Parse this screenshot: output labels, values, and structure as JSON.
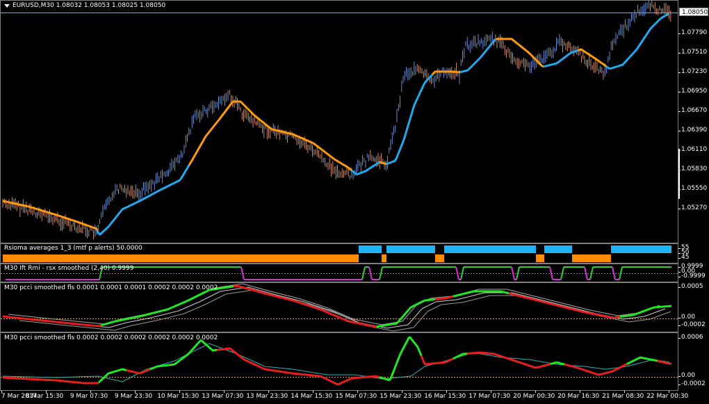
{
  "main": {
    "symbol": "EURUSD,M30",
    "ohlc": "1.08032 1.08053 1.08025 1.08050",
    "current_price": "1.08050",
    "price_ticks": [
      "1.07790",
      "1.07510",
      "1.07230",
      "1.06950",
      "1.06670",
      "1.06390",
      "1.06110",
      "1.05830",
      "1.05550",
      "1.05270"
    ],
    "colors": {
      "up_bar": "#6a8fcf",
      "down_bar": "#c98d6e",
      "ma_up": "#1fa9ef",
      "ma_down": "#ff9a10"
    }
  },
  "rsioma": {
    "title": "Rsioma averages 1_3 (mtf p alerts) 50.0000",
    "ticks": [
      "55",
      "50",
      "45"
    ],
    "colors": {
      "up": "#1fb4f5",
      "down": "#ff8c00"
    }
  },
  "ift_rmi": {
    "title": "M30 Ift Rmi - rsx smoothed (2,40) 0.9999",
    "ticks": [
      "0.9999",
      "0.00",
      "-0.9999"
    ],
    "colors": {
      "up": "#33cc33",
      "down": "#d633d6"
    }
  },
  "pcci1": {
    "title": "M30 pcci smoothed fls 0.0001 0.0001 0.0001 0.0002 0.0002 0.0002",
    "ticks": [
      "0.0005",
      "0.00",
      "-0.0002"
    ],
    "colors": {
      "up": "#22e622",
      "down": "#e61e1e",
      "level": "#d2a24c"
    }
  },
  "pcci2": {
    "title": "M30 pcci smoothed fls 0.0002 0.0002 0.0002 0.0002 0.0002 0.0002",
    "ticks": [
      "0.0006",
      "0.00",
      "-0.0002"
    ],
    "colors": {
      "up": "#22e622",
      "down": "#e61e1e",
      "signal": "#2fb3b3",
      "level": "#d2a24c"
    }
  },
  "time_axis": {
    "labels": [
      "7 Mar 2017",
      "8 Mar 15:30",
      "9 Mar 07:30",
      "9 Mar 23:30",
      "10 Mar 15:30",
      "13 Mar 07:30",
      "13 Mar 23:30",
      "14 Mar 15:30",
      "15 Mar 07:30",
      "15 Mar 23:30",
      "16 Mar 15:30",
      "17 Mar 07:30",
      "20 Mar 00:30",
      "20 Mar 16:30",
      "21 Mar 08:30",
      "22 Mar 00:30"
    ]
  }
}
